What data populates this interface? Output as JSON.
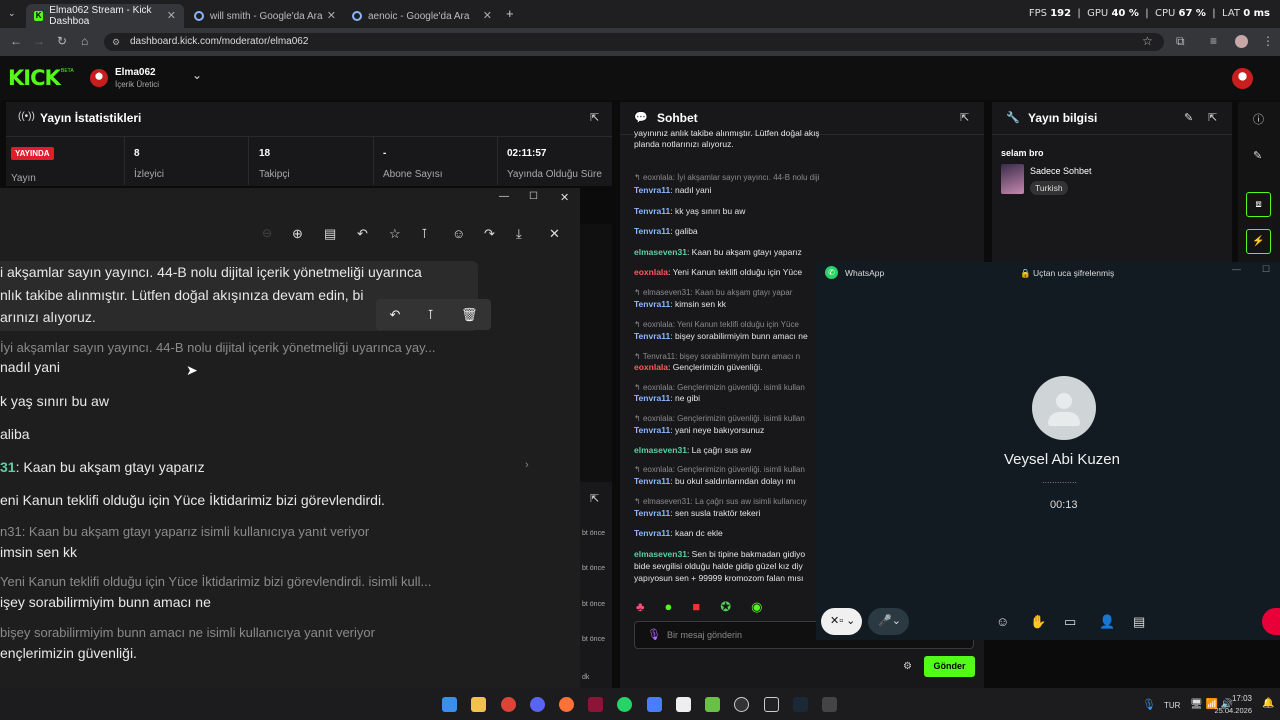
{
  "browser": {
    "tabs": [
      {
        "title": "Elma062 Stream - Kick Dashboa"
      },
      {
        "title": "will smith - Google'da Ara"
      },
      {
        "title": "aenoic - Google'da Ara"
      }
    ],
    "url": "dashboard.kick.com/moderator/elma062",
    "new_tab": "+"
  },
  "hud": {
    "fps_label": "FPS",
    "fps": "192",
    "gpu_label": "GPU",
    "gpu": "40 %",
    "cpu_label": "CPU",
    "cpu": "67 %",
    "lat_label": "LAT",
    "lat": "0 ms"
  },
  "kick": {
    "logo": "KICK",
    "beta": "BETA",
    "user": "Elma062",
    "role": "İçerik Üretici"
  },
  "stats": {
    "title": "Yayın İstatistikleri",
    "live": "YAYINDA",
    "live_label": "Yayın",
    "viewers": "8",
    "viewers_label": "İzleyici",
    "followers": "18",
    "followers_label": "Takipçi",
    "subs": "-",
    "subs_label": "Abone Sayısı",
    "uptime": "02:11:57",
    "uptime_label": "Yayında Olduğu Süre"
  },
  "chat": {
    "title": "Sohbet",
    "lines": [
      {
        "text": "yayınınız anlık takibe alınmıştır. Lütfen doğal akışınıza devam edin, biz sadece arka"
      },
      {
        "text": "planda notlarınızı alıyoruz."
      },
      {
        "reply": "eoxnlala: İyi akşamlar sayın yayıncı. 44-B nolu dijital içerik yönetmeliği uyarınca yay..."
      },
      {
        "user": "Tenvra11",
        "msg": "nadıl yani"
      },
      {
        "user": "Tenvra11",
        "msg": "kk yaş sınırı bu aw"
      },
      {
        "user": "Tenvra11",
        "msg": "galiba"
      },
      {
        "user": "elmaseven31",
        "msg": "Kaan bu akşam gtayı yaparız"
      },
      {
        "user": "eoxnlala",
        "msg": "Yeni Kanun teklifi olduğu için Yüce"
      },
      {
        "reply": "elmaseven31: Kaan bu akşam gtayı yapar"
      },
      {
        "user": "Tenvra11",
        "msg": "kimsin sen kk"
      },
      {
        "reply": "eoxnlala: Yeni Kanun teklifi olduğu için Yüce"
      },
      {
        "user": "Tenvra11",
        "msg": "bişey sorabilirmiyim bunn amacı ne"
      },
      {
        "reply": "Tenvra11: bişey sorabilirmiyim bunn amacı n"
      },
      {
        "user": "eoxnlala",
        "msg": "Gençlerimizin güvenliği."
      },
      {
        "reply": "eoxnlala: Gençlerimizin güvenliği. isimli kullan"
      },
      {
        "user": "Tenvra11",
        "msg": "ne gibi"
      },
      {
        "reply": "eoxnlala: Gençlerimizin güvenliği. isimli kullan"
      },
      {
        "user": "Tenvra11",
        "msg": "yani neye bakıyorsunuz"
      },
      {
        "user": "elmaseven31",
        "msg": "La çağrı sus aw"
      },
      {
        "reply": "eoxnlala: Gençlerimizin güvenliği. isimli kullan"
      },
      {
        "user": "Tenvra11",
        "msg": "bu okul saldırılarından dolayı mı"
      },
      {
        "reply": "elmaseven31: La çağrı sus aw isimli kullanıcıy"
      },
      {
        "user": "Tenvra11",
        "msg": "sen susla traktör tekeri"
      },
      {
        "user": "Tenvra11",
        "msg": "kaan dc ekle"
      },
      {
        "user": "elmaseven31",
        "msg": "Sen bi tipine bakmadan gidiyo"
      },
      {
        "text": "bide sevgilisi olduğu halde gidip güzel kız diy"
      },
      {
        "text": "yapıyosun sen + 99999 kromozom falan mısı"
      }
    ],
    "placeholder": "Bir mesaj gönderin",
    "send": "Gönder"
  },
  "info": {
    "title": "Yayın bilgisi",
    "stream_title": "selam bro",
    "category": "Sadece Sohbet",
    "tag": "Turkish"
  },
  "viewer": {
    "lines": [
      {
        "t": "i akşamlar sayın yayıncı. 44-B nolu dijital içerik yönetmeliği uyarınca",
        "dim": false
      },
      {
        "t": "nlık takibe alınmıştır. Lütfen doğal akışınıza devam edin, bi",
        "dim": false
      },
      {
        "t": "arınızı alıyoruz.",
        "dim": false
      },
      {
        "t": "İyi akşamlar sayın yayıncı. 44-B nolu dijital içerik yönetmeliği uyarınca yay...",
        "dim": true
      },
      {
        "t": "nadıl yani",
        "dim": false
      },
      {
        "t": "k yaş sınırı bu aw",
        "dim": false
      },
      {
        "t": "aliba",
        "dim": false
      },
      {
        "u": "31",
        "t": ": Kaan bu akşam gtayı yaparız",
        "dim": false
      },
      {
        "t": "eni Kanun teklifi olduğu için Yüce İktidarimiz bizi görevlendirdi.",
        "dim": false
      },
      {
        "t": "n31: Kaan bu akşam gtayı yaparız isimli kullanıcıya yanıt veriyor",
        "dim": true
      },
      {
        "t": "imsin sen kk",
        "dim": false
      },
      {
        "t": "Yeni Kanun teklifi olduğu için Yüce İktidarimiz bizi görevlendirdi. isimli kull...",
        "dim": true
      },
      {
        "t": "işey sorabilirmiyim bunn amacı ne",
        "dim": false
      },
      {
        "t": "bişey sorabilirmiyim bunn amacı ne isimli kullanıcıya yanıt veriyor",
        "dim": true
      },
      {
        "t": "ençlerimizin güvenliği.",
        "dim": false
      }
    ]
  },
  "behind": {
    "items": [
      "bt önce",
      "bt önce",
      "bt önce",
      "bt önce",
      "dk"
    ]
  },
  "whatsapp": {
    "app": "WhatsApp",
    "e2e": "Uçtan uca şifrelenmiş",
    "contact": "Veysel Abi Kuzen",
    "status": "..............",
    "timer": "00:13"
  },
  "taskbar": {
    "lang": "TUR",
    "time": "17:03",
    "date": "25.04.2026"
  }
}
